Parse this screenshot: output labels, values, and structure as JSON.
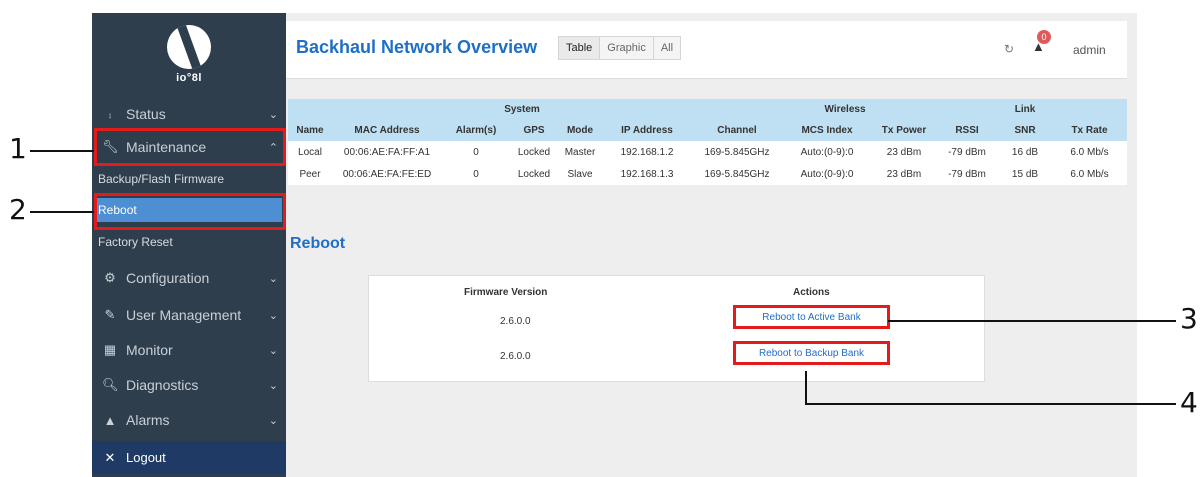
{
  "sidebar": {
    "logo_text": "io°8l",
    "items": [
      {
        "label": "Status",
        "icon": "chart-icon",
        "chevron": "⌄"
      },
      {
        "label": "Maintenance",
        "icon": "wrench-icon",
        "chevron": "⌃"
      },
      {
        "label": "Configuration",
        "icon": "gear-icon",
        "chevron": "⌄"
      },
      {
        "label": "User Management",
        "icon": "pencil-icon",
        "chevron": "⌄"
      },
      {
        "label": "Monitor",
        "icon": "monitor-icon",
        "chevron": "⌄"
      },
      {
        "label": "Diagnostics",
        "icon": "search-icon",
        "chevron": "⌄"
      },
      {
        "label": "Alarms",
        "icon": "bell-icon",
        "chevron": "⌄"
      }
    ],
    "sub_items": [
      {
        "label": "Backup/Flash Firmware"
      },
      {
        "label": "Reboot"
      },
      {
        "label": "Factory Reset"
      }
    ],
    "logout_label": "Logout"
  },
  "header": {
    "title": "Backhaul Network Overview",
    "tabs": [
      {
        "label": "Table"
      },
      {
        "label": "Graphic"
      },
      {
        "label": "All"
      }
    ],
    "notification_count": "0",
    "user": "admin"
  },
  "backhaul_table": {
    "group_headers": {
      "system": "System",
      "wireless": "Wireless",
      "link": "Link"
    },
    "columns": [
      "Name",
      "MAC Address",
      "Alarm(s)",
      "GPS",
      "Mode",
      "IP Address",
      "Channel",
      "MCS Index",
      "Tx Power",
      "RSSI",
      "SNR",
      "Tx Rate"
    ],
    "rows": [
      [
        "Local",
        "00:06:AE:FA:FF:A1",
        "0",
        "Locked",
        "Master",
        "192.168.1.2",
        "169-5.845GHz",
        "Auto:(0-9):0",
        "23 dBm",
        "-79 dBm",
        "16 dB",
        "6.0 Mb/s"
      ],
      [
        "Peer",
        "00:06:AE:FA:FE:ED",
        "0",
        "Locked",
        "Slave",
        "192.168.1.3",
        "169-5.845GHz",
        "Auto:(0-9):0",
        "23 dBm",
        "-79 dBm",
        "15 dB",
        "6.0 Mb/s"
      ]
    ]
  },
  "reboot": {
    "title": "Reboot",
    "firmware_header": "Firmware Version",
    "actions_header": "Actions",
    "banks": [
      {
        "version": "2.6.0.0",
        "action": "Reboot to Active Bank"
      },
      {
        "version": "2.6.0.0",
        "action": "Reboot to Backup Bank"
      }
    ]
  },
  "callouts": [
    "1",
    "2",
    "3",
    "4"
  ],
  "colors": {
    "sidebar_bg": "#2f3e4d",
    "active_sub": "#4e8fd4",
    "accent": "#1f6fc6",
    "highlight": "#e31b1b",
    "table_header": "#bfe0f2"
  }
}
